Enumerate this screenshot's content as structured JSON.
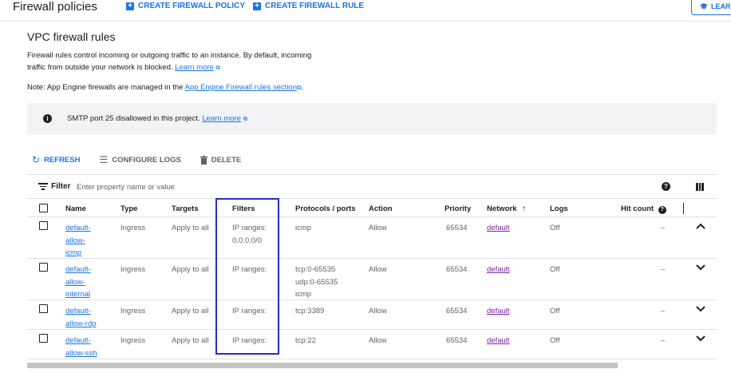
{
  "header": {
    "title": "Firewall policies",
    "create_policy": "CREATE FIREWALL POLICY",
    "create_rule": "CREATE FIREWALL RULE",
    "learn": "LEAR"
  },
  "section": {
    "title": "VPC firewall rules",
    "desc_line1": "Firewall rules control incoming or outgoing traffic to an instance. By default, incoming",
    "desc_line2": "traffic from outside your network is blocked.",
    "learn_more": "Learn more",
    "note_prefix": "Note: App Engine firewalls are managed in the",
    "note_link": "App Engine Firewall rules section",
    "note_suffix": "."
  },
  "banner": {
    "text": "SMTP port 25 disallowed in this project.",
    "link": "Learn more"
  },
  "toolbar": {
    "refresh": "REFRESH",
    "configure_logs": "CONFIGURE LOGS",
    "delete": "DELETE"
  },
  "filter": {
    "label": "Filter",
    "placeholder": "Enter property name or value"
  },
  "table": {
    "headers": {
      "name": "Name",
      "type": "Type",
      "targets": "Targets",
      "filters": "Filters",
      "protocols": "Protocols / ports",
      "action": "Action",
      "priority": "Priority",
      "network": "Network",
      "logs": "Logs",
      "hit_count": "Hit count"
    },
    "rows": [
      {
        "name_l1": "default-",
        "name_l2": "allow-",
        "name_l3": "icmp",
        "type": "Ingress",
        "targets": "Apply to all",
        "filters_l1": "IP ranges:",
        "filters_l2": "0.0.0.0/0",
        "proto_l1": "icmp",
        "proto_l2": "",
        "proto_l3": "",
        "action": "Allow",
        "priority": "65534",
        "network": "default",
        "logs": "Off",
        "hits": "–",
        "chevron": "up"
      },
      {
        "name_l1": "default-",
        "name_l2": "allow-",
        "name_l3": "internal",
        "type": "Ingress",
        "targets": "Apply to all",
        "filters_l1": "IP ranges:",
        "filters_l2": "",
        "proto_l1": "tcp:0-65535",
        "proto_l2": "udp:0-65535",
        "proto_l3": "icmp",
        "action": "Allow",
        "priority": "65534",
        "network": "default",
        "logs": "Off",
        "hits": "–",
        "chevron": "down"
      },
      {
        "name_l1": "default-",
        "name_l2": "allow-rdp",
        "name_l3": "",
        "type": "Ingress",
        "targets": "Apply to all",
        "filters_l1": "IP ranges:",
        "filters_l2": "",
        "proto_l1": "tcp:3389",
        "proto_l2": "",
        "proto_l3": "",
        "action": "Allow",
        "priority": "65534",
        "network": "default",
        "logs": "Off",
        "hits": "–",
        "chevron": "down"
      },
      {
        "name_l1": "default-",
        "name_l2": "allow-ssh",
        "name_l3": "",
        "type": "Ingress",
        "targets": "Apply to all",
        "filters_l1": "IP ranges:",
        "filters_l2": "",
        "proto_l1": "tcp:22",
        "proto_l2": "",
        "proto_l3": "",
        "action": "Allow",
        "priority": "65534",
        "network": "default",
        "logs": "Off",
        "hits": "–",
        "chevron": "down"
      }
    ]
  },
  "icons": {
    "plus": "+",
    "info": "i",
    "help": "?",
    "refresh": "↻",
    "configure_logs": "☰",
    "delete": "🗑",
    "sort_up": "↑",
    "chevron_up": "⌃",
    "chevron_down": "⌄"
  },
  "colors": {
    "accent": "#1a73e8",
    "network_link": "#7b1fa2",
    "highlight_box": "#2c2ccc"
  }
}
